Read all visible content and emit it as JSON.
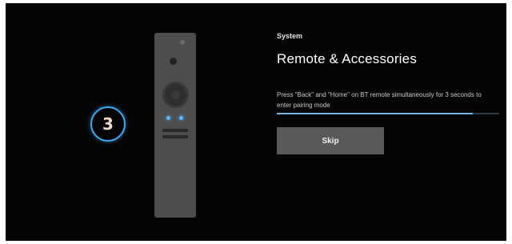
{
  "setup": {
    "category": "System",
    "title": "Remote & Accessories",
    "instruction": "Press \"Back\" and \"Home\" on BT remote simultaneously for 3 seconds to enter pairing mode",
    "countdown": "3",
    "progress_fraction": 0.88,
    "skip_label": "Skip"
  },
  "icons": {
    "remote": "remote-control-icon",
    "power": "power-icon",
    "dpad": "dpad-icon"
  },
  "colors": {
    "background": "#050505",
    "accent": "#3fa9f5",
    "button": "#595959"
  }
}
